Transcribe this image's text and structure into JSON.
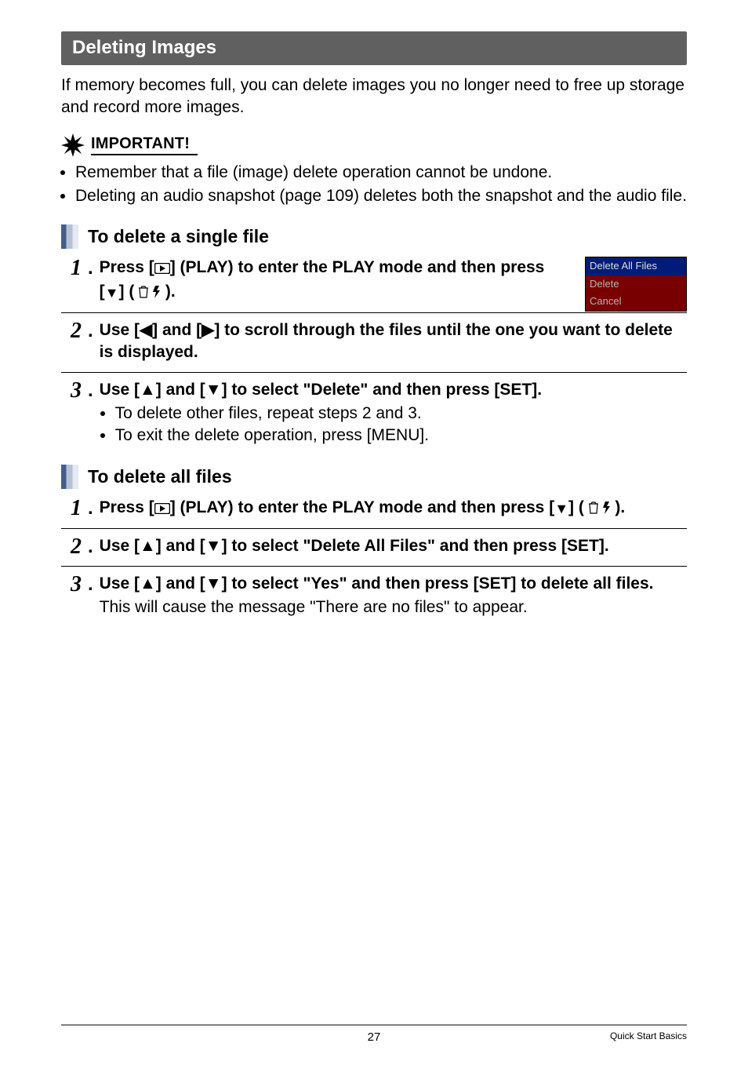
{
  "section": {
    "title": "Deleting Images"
  },
  "intro": "If memory becomes full, you can delete images you no longer need to free up storage and record more images.",
  "important": {
    "label": "IMPORTANT!",
    "items": [
      "Remember that a file (image) delete operation cannot be undone.",
      "Deleting an audio snapshot (page 109) deletes both the snapshot and the audio file."
    ]
  },
  "singleFile": {
    "heading": "To delete a single file",
    "step1_a": "Press [",
    "step1_b": "] (PLAY) to enter the PLAY mode and then press [",
    "step1_c": "] (",
    "step1_d": ").",
    "step2": "Use [◀] and [▶] to scroll through the files until the one you want to delete is displayed.",
    "step3": "Use [▲] and [▼] to select \"Delete\" and then press [SET].",
    "step3_notes": [
      "To delete other files, repeat steps 2 and 3.",
      "To exit the delete operation, press [MENU]."
    ],
    "menu": {
      "row1": "Delete All Files",
      "row2": "Delete",
      "row3": "Cancel"
    }
  },
  "allFiles": {
    "heading": "To delete all files",
    "step1_a": "Press [",
    "step1_b": "] (PLAY) to enter the PLAY mode and then press [",
    "step1_c": "] (",
    "step1_d": ").",
    "step2": "Use [▲] and [▼] to select \"Delete All Files\" and then press [SET].",
    "step3": "Use [▲] and [▼] to select \"Yes\" and then press [SET] to delete all files.",
    "step3_note": "This will cause the message \"There are no files\" to appear."
  },
  "glyphs": {
    "down": "▼",
    "up": "▲",
    "left": "◀",
    "right": "▶"
  },
  "footer": {
    "page_number": "27",
    "chapter": "Quick Start Basics"
  }
}
